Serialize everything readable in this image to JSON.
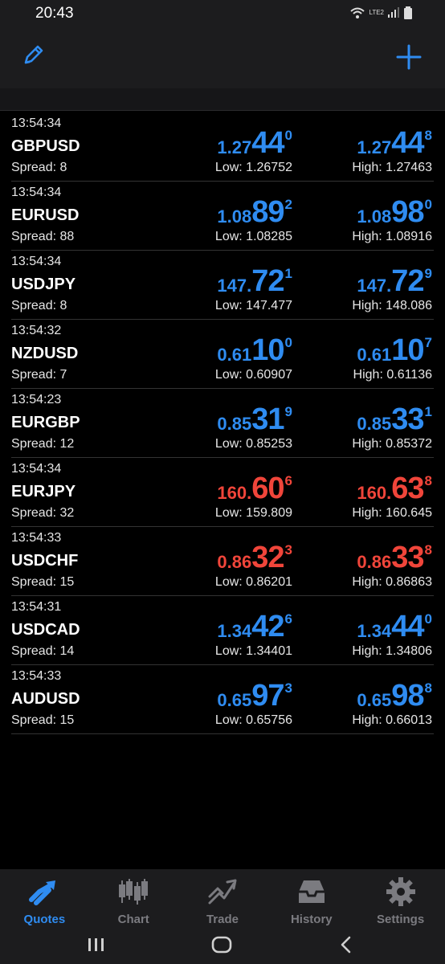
{
  "status_bar": {
    "time": "20:43",
    "network": "LTE2"
  },
  "quotes": [
    {
      "time": "13:54:34",
      "symbol": "GBPUSD",
      "spread": "Spread: 8",
      "color": "#2f8cf1",
      "bid": {
        "small": "1.27",
        "big": "44",
        "sup": "0"
      },
      "ask": {
        "small": "1.27",
        "big": "44",
        "sup": "8"
      },
      "low": "Low: 1.26752",
      "high": "High: 1.27463"
    },
    {
      "time": "13:54:34",
      "symbol": "EURUSD",
      "spread": "Spread: 88",
      "color": "#2f8cf1",
      "bid": {
        "small": "1.08",
        "big": "89",
        "sup": "2"
      },
      "ask": {
        "small": "1.08",
        "big": "98",
        "sup": "0"
      },
      "low": "Low: 1.08285",
      "high": "High: 1.08916"
    },
    {
      "time": "13:54:34",
      "symbol": "USDJPY",
      "spread": "Spread: 8",
      "color": "#2f8cf1",
      "bid": {
        "small": "147.",
        "big": "72",
        "sup": "1"
      },
      "ask": {
        "small": "147.",
        "big": "72",
        "sup": "9"
      },
      "low": "Low: 147.477",
      "high": "High: 148.086"
    },
    {
      "time": "13:54:32",
      "symbol": "NZDUSD",
      "spread": "Spread: 7",
      "color": "#2f8cf1",
      "bid": {
        "small": "0.61",
        "big": "10",
        "sup": "0"
      },
      "ask": {
        "small": "0.61",
        "big": "10",
        "sup": "7"
      },
      "low": "Low: 0.60907",
      "high": "High: 0.61136"
    },
    {
      "time": "13:54:23",
      "symbol": "EURGBP",
      "spread": "Spread: 12",
      "color": "#2f8cf1",
      "bid": {
        "small": "0.85",
        "big": "31",
        "sup": "9"
      },
      "ask": {
        "small": "0.85",
        "big": "33",
        "sup": "1"
      },
      "low": "Low: 0.85253",
      "high": "High: 0.85372"
    },
    {
      "time": "13:54:34",
      "symbol": "EURJPY",
      "spread": "Spread: 32",
      "color": "#f0453a",
      "bid": {
        "small": "160.",
        "big": "60",
        "sup": "6"
      },
      "ask": {
        "small": "160.",
        "big": "63",
        "sup": "8"
      },
      "low": "Low: 159.809",
      "high": "High: 160.645"
    },
    {
      "time": "13:54:33",
      "symbol": "USDCHF",
      "spread": "Spread: 15",
      "color": "#f0453a",
      "bid": {
        "small": "0.86",
        "big": "32",
        "sup": "3"
      },
      "ask": {
        "small": "0.86",
        "big": "33",
        "sup": "8"
      },
      "low": "Low: 0.86201",
      "high": "High: 0.86863"
    },
    {
      "time": "13:54:31",
      "symbol": "USDCAD",
      "spread": "Spread: 14",
      "color": "#2f8cf1",
      "bid": {
        "small": "1.34",
        "big": "42",
        "sup": "6"
      },
      "ask": {
        "small": "1.34",
        "big": "44",
        "sup": "0"
      },
      "low": "Low: 1.34401",
      "high": "High: 1.34806"
    },
    {
      "time": "13:54:33",
      "symbol": "AUDUSD",
      "spread": "Spread: 15",
      "color": "#2f8cf1",
      "bid": {
        "small": "0.65",
        "big": "97",
        "sup": "3"
      },
      "ask": {
        "small": "0.65",
        "big": "98",
        "sup": "8"
      },
      "low": "Low: 0.65756",
      "high": "High: 0.66013"
    }
  ],
  "nav": [
    {
      "label": "Quotes",
      "icon": "quotes-icon",
      "active": true
    },
    {
      "label": "Chart",
      "icon": "chart-icon",
      "active": false
    },
    {
      "label": "Trade",
      "icon": "trade-icon",
      "active": false
    },
    {
      "label": "History",
      "icon": "history-icon",
      "active": false
    },
    {
      "label": "Settings",
      "icon": "settings-icon",
      "active": false
    }
  ],
  "colors": {
    "accent": "#2f8cf1",
    "down": "#f0453a",
    "inactive": "#7b7b80"
  }
}
